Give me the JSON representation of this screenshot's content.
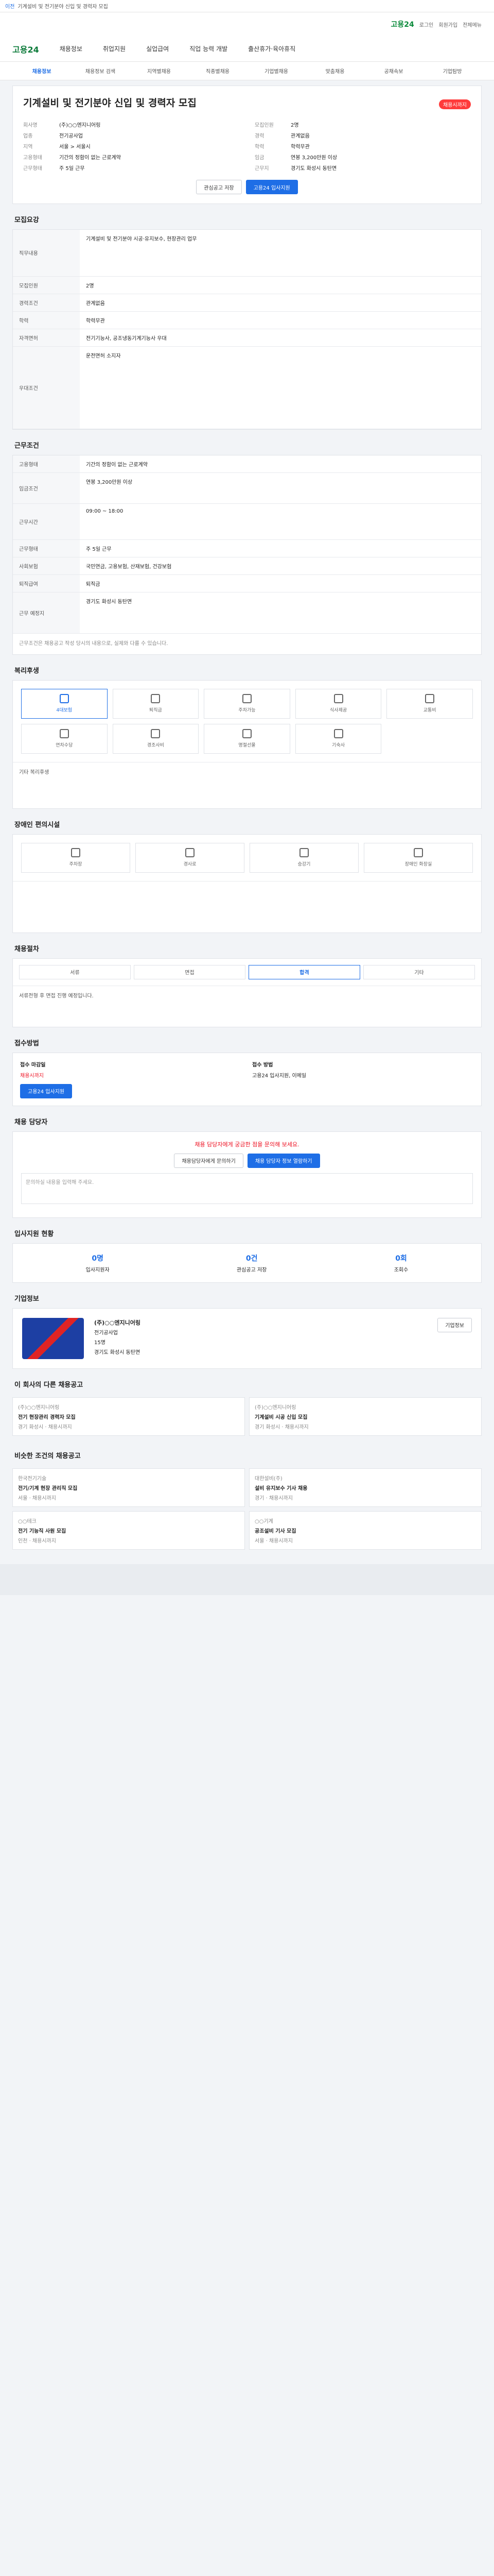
{
  "topbar": {
    "back": "이전",
    "title": "기계설비 및 전기분야 신입 및 경력자 모집"
  },
  "sub": {
    "logo": "고용24",
    "links": [
      "로그인",
      "회원가입",
      "전체메뉴"
    ]
  },
  "gnb": {
    "brand": "고용24",
    "menus": [
      "채용정보",
      "취업지원",
      "실업급여",
      "직업 능력 개발",
      "출산휴가·육아휴직"
    ]
  },
  "lnb": {
    "items": [
      "채용정보",
      "채용정보 검색",
      "지역별채용",
      "직종별채용",
      "기업별채용",
      "맞춤채용",
      "공채속보",
      "기업탐방"
    ]
  },
  "job": {
    "title": "기계설비 및 전기분야 신입 및 경력자 모집",
    "badge": "채용시까지",
    "left": [
      {
        "k": "회사명",
        "v": "(주)○○엔지니어링"
      },
      {
        "k": "업종",
        "v": "전기공사업"
      },
      {
        "k": "지역",
        "v": "서울 > 서울시"
      },
      {
        "k": "고용형태",
        "v": "기간의 정함이 없는 근로계약"
      },
      {
        "k": "근무형태",
        "v": "주 5일 근무"
      }
    ],
    "right": [
      {
        "k": "모집인원",
        "v": "2명"
      },
      {
        "k": "경력",
        "v": "관계없음"
      },
      {
        "k": "학력",
        "v": "학력무관"
      },
      {
        "k": "임금",
        "v": "연봉 3,200만원 이상"
      },
      {
        "k": "근무지",
        "v": "경기도 화성시 동탄면"
      }
    ],
    "btn_scrap": "관심공고 저장",
    "btn_apply": "고용24 입사지원"
  },
  "sections": {
    "recruit": "모집요강",
    "conditions": "근무조건",
    "welfare": "복리후생",
    "facilities": "장애인 편의시설",
    "process": "채용절차",
    "how": "접수방법",
    "contact": "채용 담당자",
    "stats": "입사지원 현황",
    "company": "기업정보",
    "related": "이 회사의 다른 채용공고",
    "similar": "비슷한 조건의 채용공고"
  },
  "recruit": [
    {
      "k": "직무내용",
      "v": "기계설비 및 전기분야 시공·유지보수, 현장관리 업무"
    },
    {
      "k": "모집인원",
      "v": "2명"
    },
    {
      "k": "경력조건",
      "v": "관계없음"
    },
    {
      "k": "학력",
      "v": "학력무관"
    },
    {
      "k": "자격면허",
      "v": "전기기능사, 공조냉동기계기능사 우대"
    },
    {
      "k": "우대조건",
      "v": "운전면허 소지자"
    }
  ],
  "conditions": [
    {
      "k": "고용형태",
      "v": "기간의 정함이 없는 근로계약"
    },
    {
      "k": "임금조건",
      "v": "연봉 3,200만원 이상"
    },
    {
      "k": "근무시간",
      "v": "09:00 ~ 18:00"
    },
    {
      "k": "근무형태",
      "v": "주 5일 근무"
    },
    {
      "k": "사회보험",
      "v": "국민연금, 고용보험, 산재보험, 건강보험"
    },
    {
      "k": "퇴직급여",
      "v": "퇴직금"
    },
    {
      "k": "근무 예정지",
      "v": "경기도 화성시 동탄면"
    }
  ],
  "conditions_note": "근무조건은 채용공고 작성 당시의 내용으로, 실제와 다를 수 있습니다.",
  "welfare_tiles": [
    "4대보험",
    "퇴직금",
    "주차가능",
    "식사제공",
    "교통비",
    "연차수당",
    "경조사비",
    "명절선물",
    "기숙사"
  ],
  "welfare_etc": "기타 복리후생",
  "facilities_tiles": [
    "주차장",
    "경사로",
    "승강기",
    "장애인 화장실"
  ],
  "process_tabs": [
    "서류",
    "면접",
    "합격",
    "기타"
  ],
  "process_note": "서류전형 후 면접 진행 예정입니다.",
  "how": {
    "lbl_period": "접수 마감일",
    "period": "채용시까지",
    "lbl_method": "접수 방법",
    "methods": "고용24 입사지원, 이메일",
    "apply_btn": "고용24 입사지원"
  },
  "contact": {
    "msg": "채용 담당자에게 궁금한 점을 문의해 보세요.",
    "btn1": "채용담당자에게 문의하기",
    "btn2": "채용 담당자 정보 열람하기",
    "ask_placeholder": "문의하실 내용을 입력해 주세요."
  },
  "stats": [
    {
      "num": "0명",
      "lbl": "입사지원자"
    },
    {
      "num": "0건",
      "lbl": "관심공고 저장"
    },
    {
      "num": "0회",
      "lbl": "조회수"
    }
  ],
  "company": {
    "name": "(주)○○엔지니어링",
    "industry": "전기공사업",
    "employees": "15명",
    "address": "경기도 화성시 동탄면",
    "btn": "기업정보"
  },
  "related": [
    {
      "co": "(주)○○엔지니어링",
      "title": "전기 현장관리 경력자 모집",
      "meta": "경기 화성시 · 채용시까지"
    },
    {
      "co": "(주)○○엔지니어링",
      "title": "기계설비 시공 신입 모집",
      "meta": "경기 화성시 · 채용시까지"
    }
  ],
  "similar": [
    {
      "co": "한국전기기술",
      "title": "전기/기계 현장 관리직 모집",
      "meta": "서울 · 채용시까지"
    },
    {
      "co": "대한설비(주)",
      "title": "설비 유지보수 기사 채용",
      "meta": "경기 · 채용시까지"
    },
    {
      "co": "○○테크",
      "title": "전기 기능직 사원 모집",
      "meta": "인천 · 채용시까지"
    },
    {
      "co": "○○기계",
      "title": "공조설비 기사 모집",
      "meta": "서울 · 채용시까지"
    }
  ]
}
